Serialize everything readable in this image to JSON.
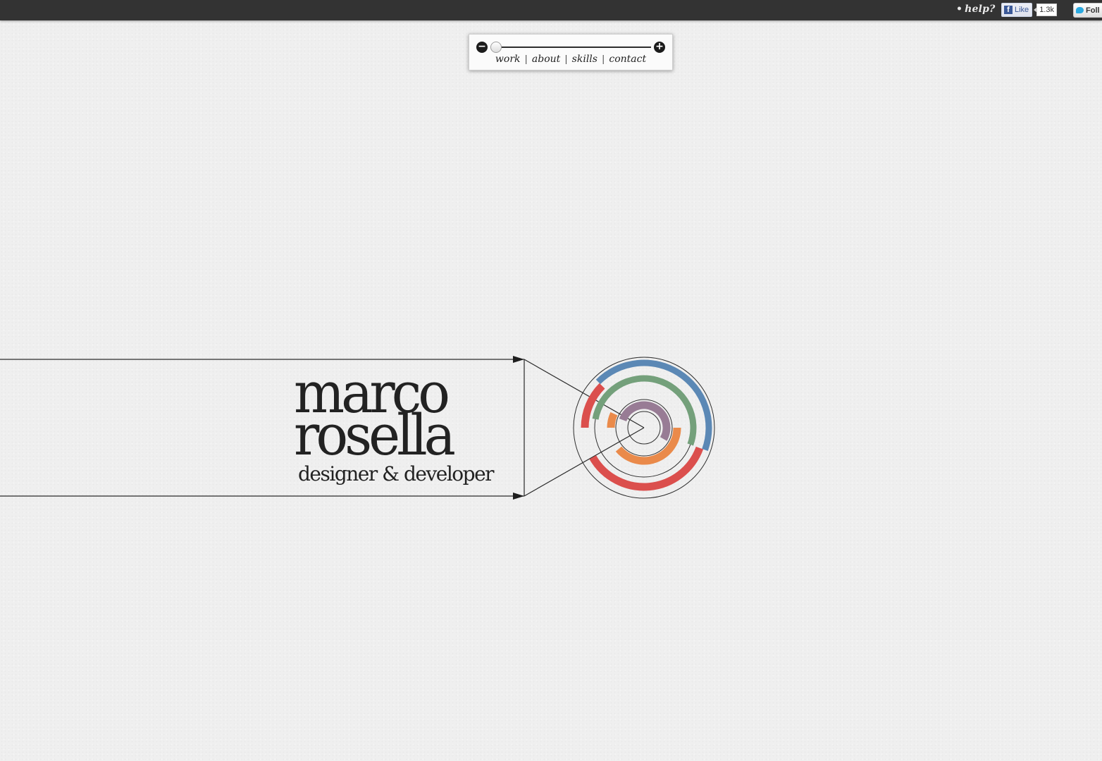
{
  "topbar": {
    "help": {
      "bullet": "•",
      "label": "help?"
    },
    "facebook": {
      "logo_glyph": "f",
      "label": "Like",
      "count": "1.3k"
    },
    "twitter": {
      "label": "Foll"
    }
  },
  "zoom": {
    "out_icon": "−",
    "in_icon": "+",
    "level": 0.0
  },
  "nav": {
    "links": [
      "work",
      "about",
      "skills",
      "contact"
    ],
    "separator": "|"
  },
  "hero": {
    "name_line1": "marco",
    "name_line2": "rosella",
    "tagline": "designer & developer"
  },
  "skills_rings": {
    "colors": {
      "blue": "#5b88b5",
      "green": "#74a07b",
      "purple": "#987c95",
      "orange": "#ea8a4a",
      "red": "#db4f4d",
      "outline": "#2e2e2e"
    }
  }
}
